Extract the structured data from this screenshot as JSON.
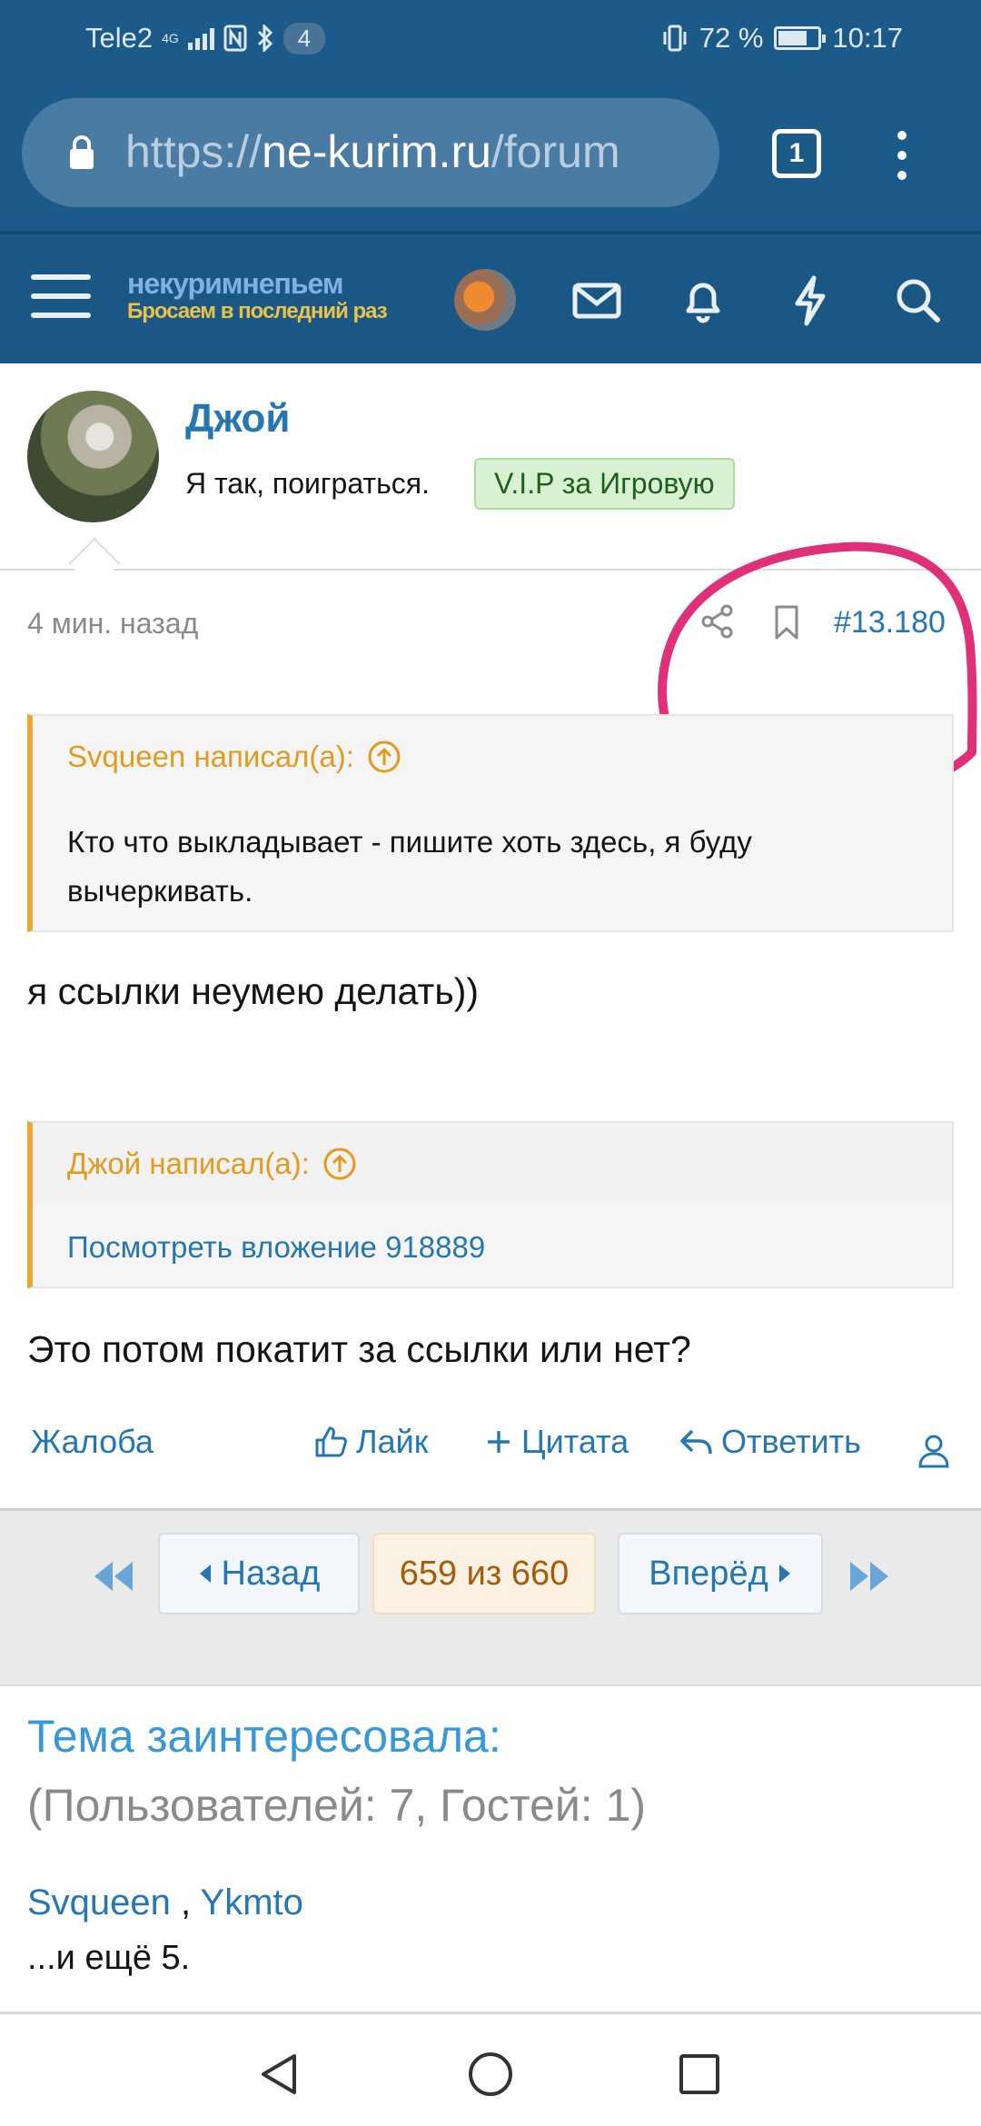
{
  "status_bar": {
    "carrier": "Tele2",
    "network": "4G",
    "notification_count": "4",
    "battery": "72 %",
    "battery_level": 0.72,
    "time": "10:17"
  },
  "browser": {
    "url_scheme": "https://",
    "url_host": "ne-kurim.ru",
    "url_path": "/forum",
    "tab_count": "1"
  },
  "site_header": {
    "logo_line1": "некуримнепьем",
    "logo_line2": "Бросаем в последний раз",
    "icons": [
      "menu-icon",
      "mail-icon",
      "bell-icon",
      "lightning-icon",
      "search-icon"
    ]
  },
  "post": {
    "author": "Джой",
    "user_title": "Я так, поиграться.",
    "badge": "V.I.P за Игровую",
    "time": "4 мин. назад",
    "number": "#13.180",
    "quote1": {
      "author": "Svqueen написал(а):",
      "text": "Кто что выкладывает - пишите хоть здесь, я буду вычеркивать."
    },
    "text1": "я ссылки неумею делать))",
    "quote2": {
      "author": "Джой написал(а):",
      "link": "Посмотреть вложение 918889"
    },
    "text2": "Это потом покатит за ссылки или нет?",
    "actions": {
      "report": "Жалоба",
      "like": "Лайк",
      "quote": "Цитата",
      "reply": "Ответить"
    }
  },
  "pagination": {
    "prev": "Назад",
    "current": "659 из 660",
    "next": "Вперёд"
  },
  "interested": {
    "title": "Тема заинтересовала:",
    "counts": "(Пользователей: 7, Гостей: 1)",
    "user1": "Svqueen",
    "separator": " , ",
    "user2": "Ykmto",
    "more": "...и ещё 5."
  },
  "colors": {
    "header_blue": "#1b5785",
    "link_blue": "#2577b1",
    "quote_orange": "#e39a1f",
    "highlight_pink": "#e0307a"
  }
}
